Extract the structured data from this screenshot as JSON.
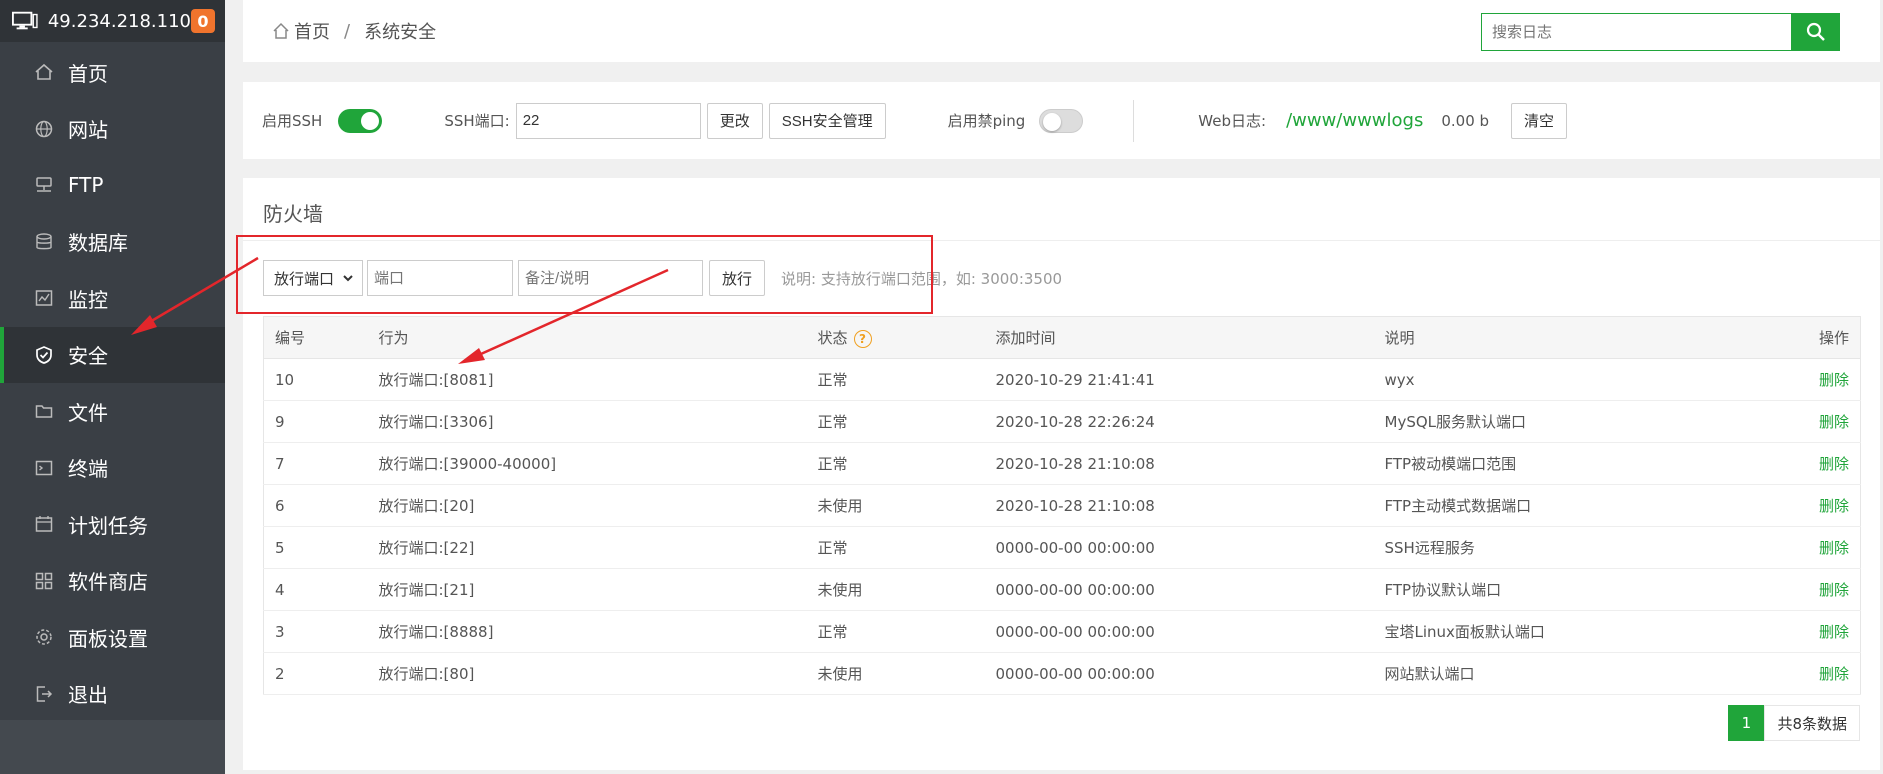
{
  "sidebar": {
    "host": "49.234.218.110",
    "badge": "0",
    "items": [
      {
        "label": "首页",
        "icon": "home-icon"
      },
      {
        "label": "网站",
        "icon": "globe-icon"
      },
      {
        "label": "FTP",
        "icon": "ftp-icon"
      },
      {
        "label": "数据库",
        "icon": "database-icon"
      },
      {
        "label": "监控",
        "icon": "monitor-icon"
      },
      {
        "label": "安全",
        "icon": "shield-icon"
      },
      {
        "label": "文件",
        "icon": "folder-icon"
      },
      {
        "label": "终端",
        "icon": "terminal-icon"
      },
      {
        "label": "计划任务",
        "icon": "calendar-icon"
      },
      {
        "label": "软件商店",
        "icon": "apps-icon"
      },
      {
        "label": "面板设置",
        "icon": "gear-icon"
      },
      {
        "label": "退出",
        "icon": "logout-icon"
      }
    ],
    "active_index": 5
  },
  "header": {
    "breadcrumb_home": "首页",
    "breadcrumb_sep": "/",
    "breadcrumb_current": "系统安全",
    "search_placeholder": "搜索日志"
  },
  "ssh": {
    "enable_label": "启用SSH",
    "enabled": true,
    "port_label": "SSH端口:",
    "port_value": "22",
    "change_button": "更改",
    "manage_button": "SSH安全管理",
    "ping_label": "启用禁ping",
    "ping_enabled": false,
    "weblog_label": "Web日志:",
    "weblog_path": "/www/wwwlogs",
    "weblog_size": "0.00 b",
    "clear_button": "清空"
  },
  "firewall": {
    "title": "防火墙",
    "select_value": "放行端口",
    "port_placeholder": "端口",
    "remark_placeholder": "备注/说明",
    "allow_button": "放行",
    "note": "说明: 支持放行端口范围，如: 3000:3500",
    "columns": [
      "编号",
      "行为",
      "状态",
      "添加时间",
      "说明",
      "操作"
    ],
    "rows": [
      {
        "id": "10",
        "action": "放行端口:[8081]",
        "status": "正常",
        "time": "2020-10-29 21:41:41",
        "desc": "wyx",
        "op": "删除"
      },
      {
        "id": "9",
        "action": "放行端口:[3306]",
        "status": "正常",
        "time": "2020-10-28 22:26:24",
        "desc": "MySQL服务默认端口",
        "op": "删除"
      },
      {
        "id": "7",
        "action": "放行端口:[39000-40000]",
        "status": "正常",
        "time": "2020-10-28 21:10:08",
        "desc": "FTP被动模端口范围",
        "op": "删除"
      },
      {
        "id": "6",
        "action": "放行端口:[20]",
        "status": "未使用",
        "time": "2020-10-28 21:10:08",
        "desc": "FTP主动模式数据端口",
        "op": "删除"
      },
      {
        "id": "5",
        "action": "放行端口:[22]",
        "status": "正常",
        "time": "0000-00-00 00:00:00",
        "desc": "SSH远程服务",
        "op": "删除"
      },
      {
        "id": "4",
        "action": "放行端口:[21]",
        "status": "未使用",
        "time": "0000-00-00 00:00:00",
        "desc": "FTP协议默认端口",
        "op": "删除"
      },
      {
        "id": "3",
        "action": "放行端口:[8888]",
        "status": "正常",
        "time": "0000-00-00 00:00:00",
        "desc": "宝塔Linux面板默认端口",
        "op": "删除"
      },
      {
        "id": "2",
        "action": "放行端口:[80]",
        "status": "未使用",
        "time": "0000-00-00 00:00:00",
        "desc": "网站默认端口",
        "op": "删除"
      }
    ],
    "pager_current": "1",
    "pager_total": "共8条数据"
  },
  "colors": {
    "accent": "#20a53a",
    "sidebar_bg": "#3a3f45",
    "annotation_red": "#e3262b",
    "badge": "#f0742d"
  }
}
